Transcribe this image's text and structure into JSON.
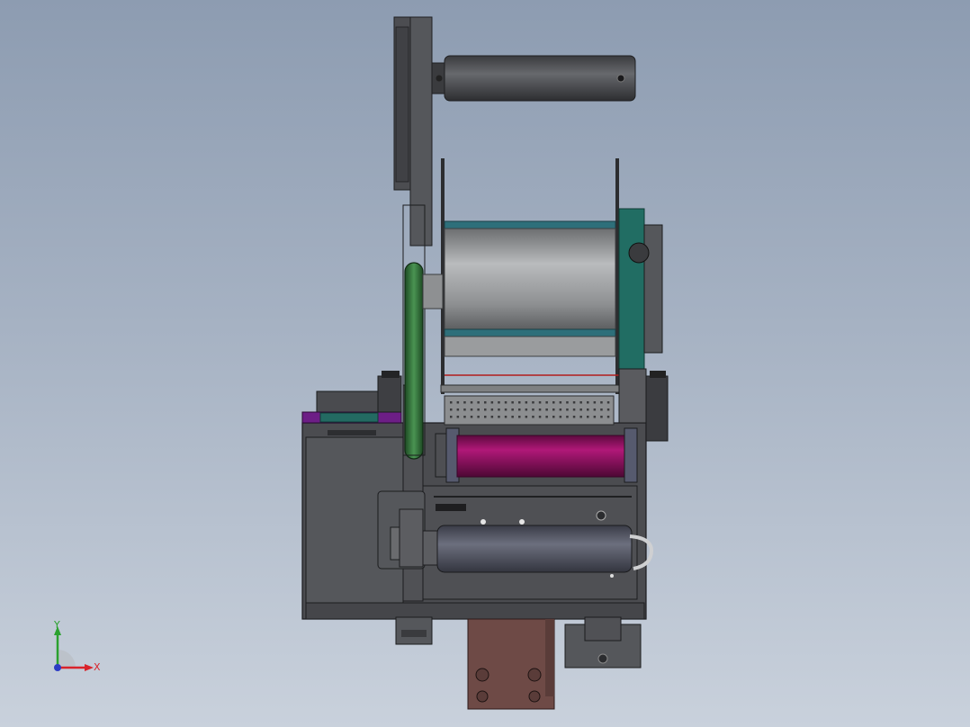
{
  "viewport": {
    "background_top": "#8d9cb1",
    "background_bottom": "#c9d1dc"
  },
  "triad": {
    "x_label": "X",
    "y_label": "Y",
    "x_color": "#d9232b",
    "y_color": "#2aa12f",
    "z_color": "#2c3cc4"
  },
  "model": {
    "body_color": "#4a4c50",
    "body_dark": "#2b2c2f",
    "drum_color": "#8a8c8f",
    "magenta_roller": "#8e1061",
    "green_belt": "#2e6b35",
    "teal_part": "#216d63",
    "purple_plate": "#6d1e86",
    "brown_bracket": "#6e4a46",
    "bottom_roller": "#4f5261"
  }
}
